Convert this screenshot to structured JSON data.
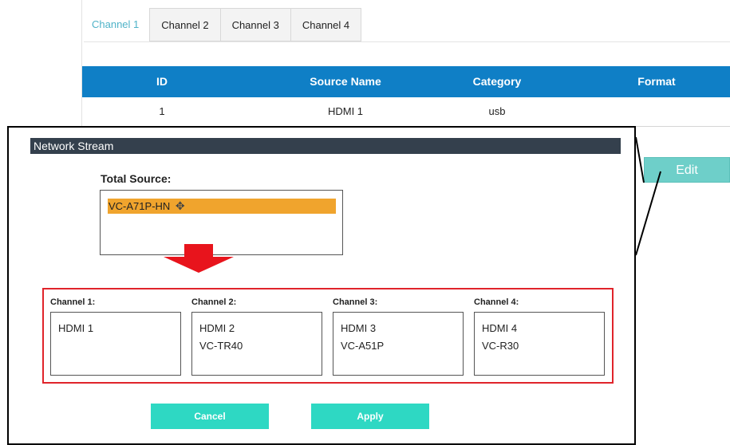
{
  "tabs": [
    {
      "label": "Channel 1"
    },
    {
      "label": "Channel 2"
    },
    {
      "label": "Channel 3"
    },
    {
      "label": "Channel 4"
    }
  ],
  "table": {
    "headers": [
      "ID",
      "Source Name",
      "Category",
      "Format"
    ],
    "rows": [
      {
        "id": "1",
        "source_name": "HDMI 1",
        "category": "usb",
        "format": ""
      }
    ]
  },
  "edit_label": "Edit",
  "modal": {
    "title": "Network Stream",
    "total_source_label": "Total Source:",
    "total_source_items": [
      "VC-A71P-HN"
    ],
    "channels": [
      {
        "label": "Channel 1:",
        "items": [
          "HDMI 1"
        ]
      },
      {
        "label": "Channel 2:",
        "items": [
          "HDMI 2",
          "VC-TR40"
        ]
      },
      {
        "label": "Channel 3:",
        "items": [
          "HDMI 3",
          "VC-A51P"
        ]
      },
      {
        "label": "Channel 4:",
        "items": [
          "HDMI 4",
          "VC-R30"
        ]
      }
    ],
    "cancel_label": "Cancel",
    "apply_label": "Apply"
  },
  "colors": {
    "active_tab": "#4fb3c8",
    "table_header": "#0f7fc6",
    "edit_button": "#6ecfc9",
    "modal_title_bar": "#34404d",
    "selected_item": "#f0a42d",
    "highlight_frame": "#e0242b",
    "arrow": "#e8141c",
    "action_buttons": "#2ed8c3"
  },
  "icons": {
    "move_cursor": "move-cursor-icon",
    "down_arrow": "down-arrow-icon"
  }
}
